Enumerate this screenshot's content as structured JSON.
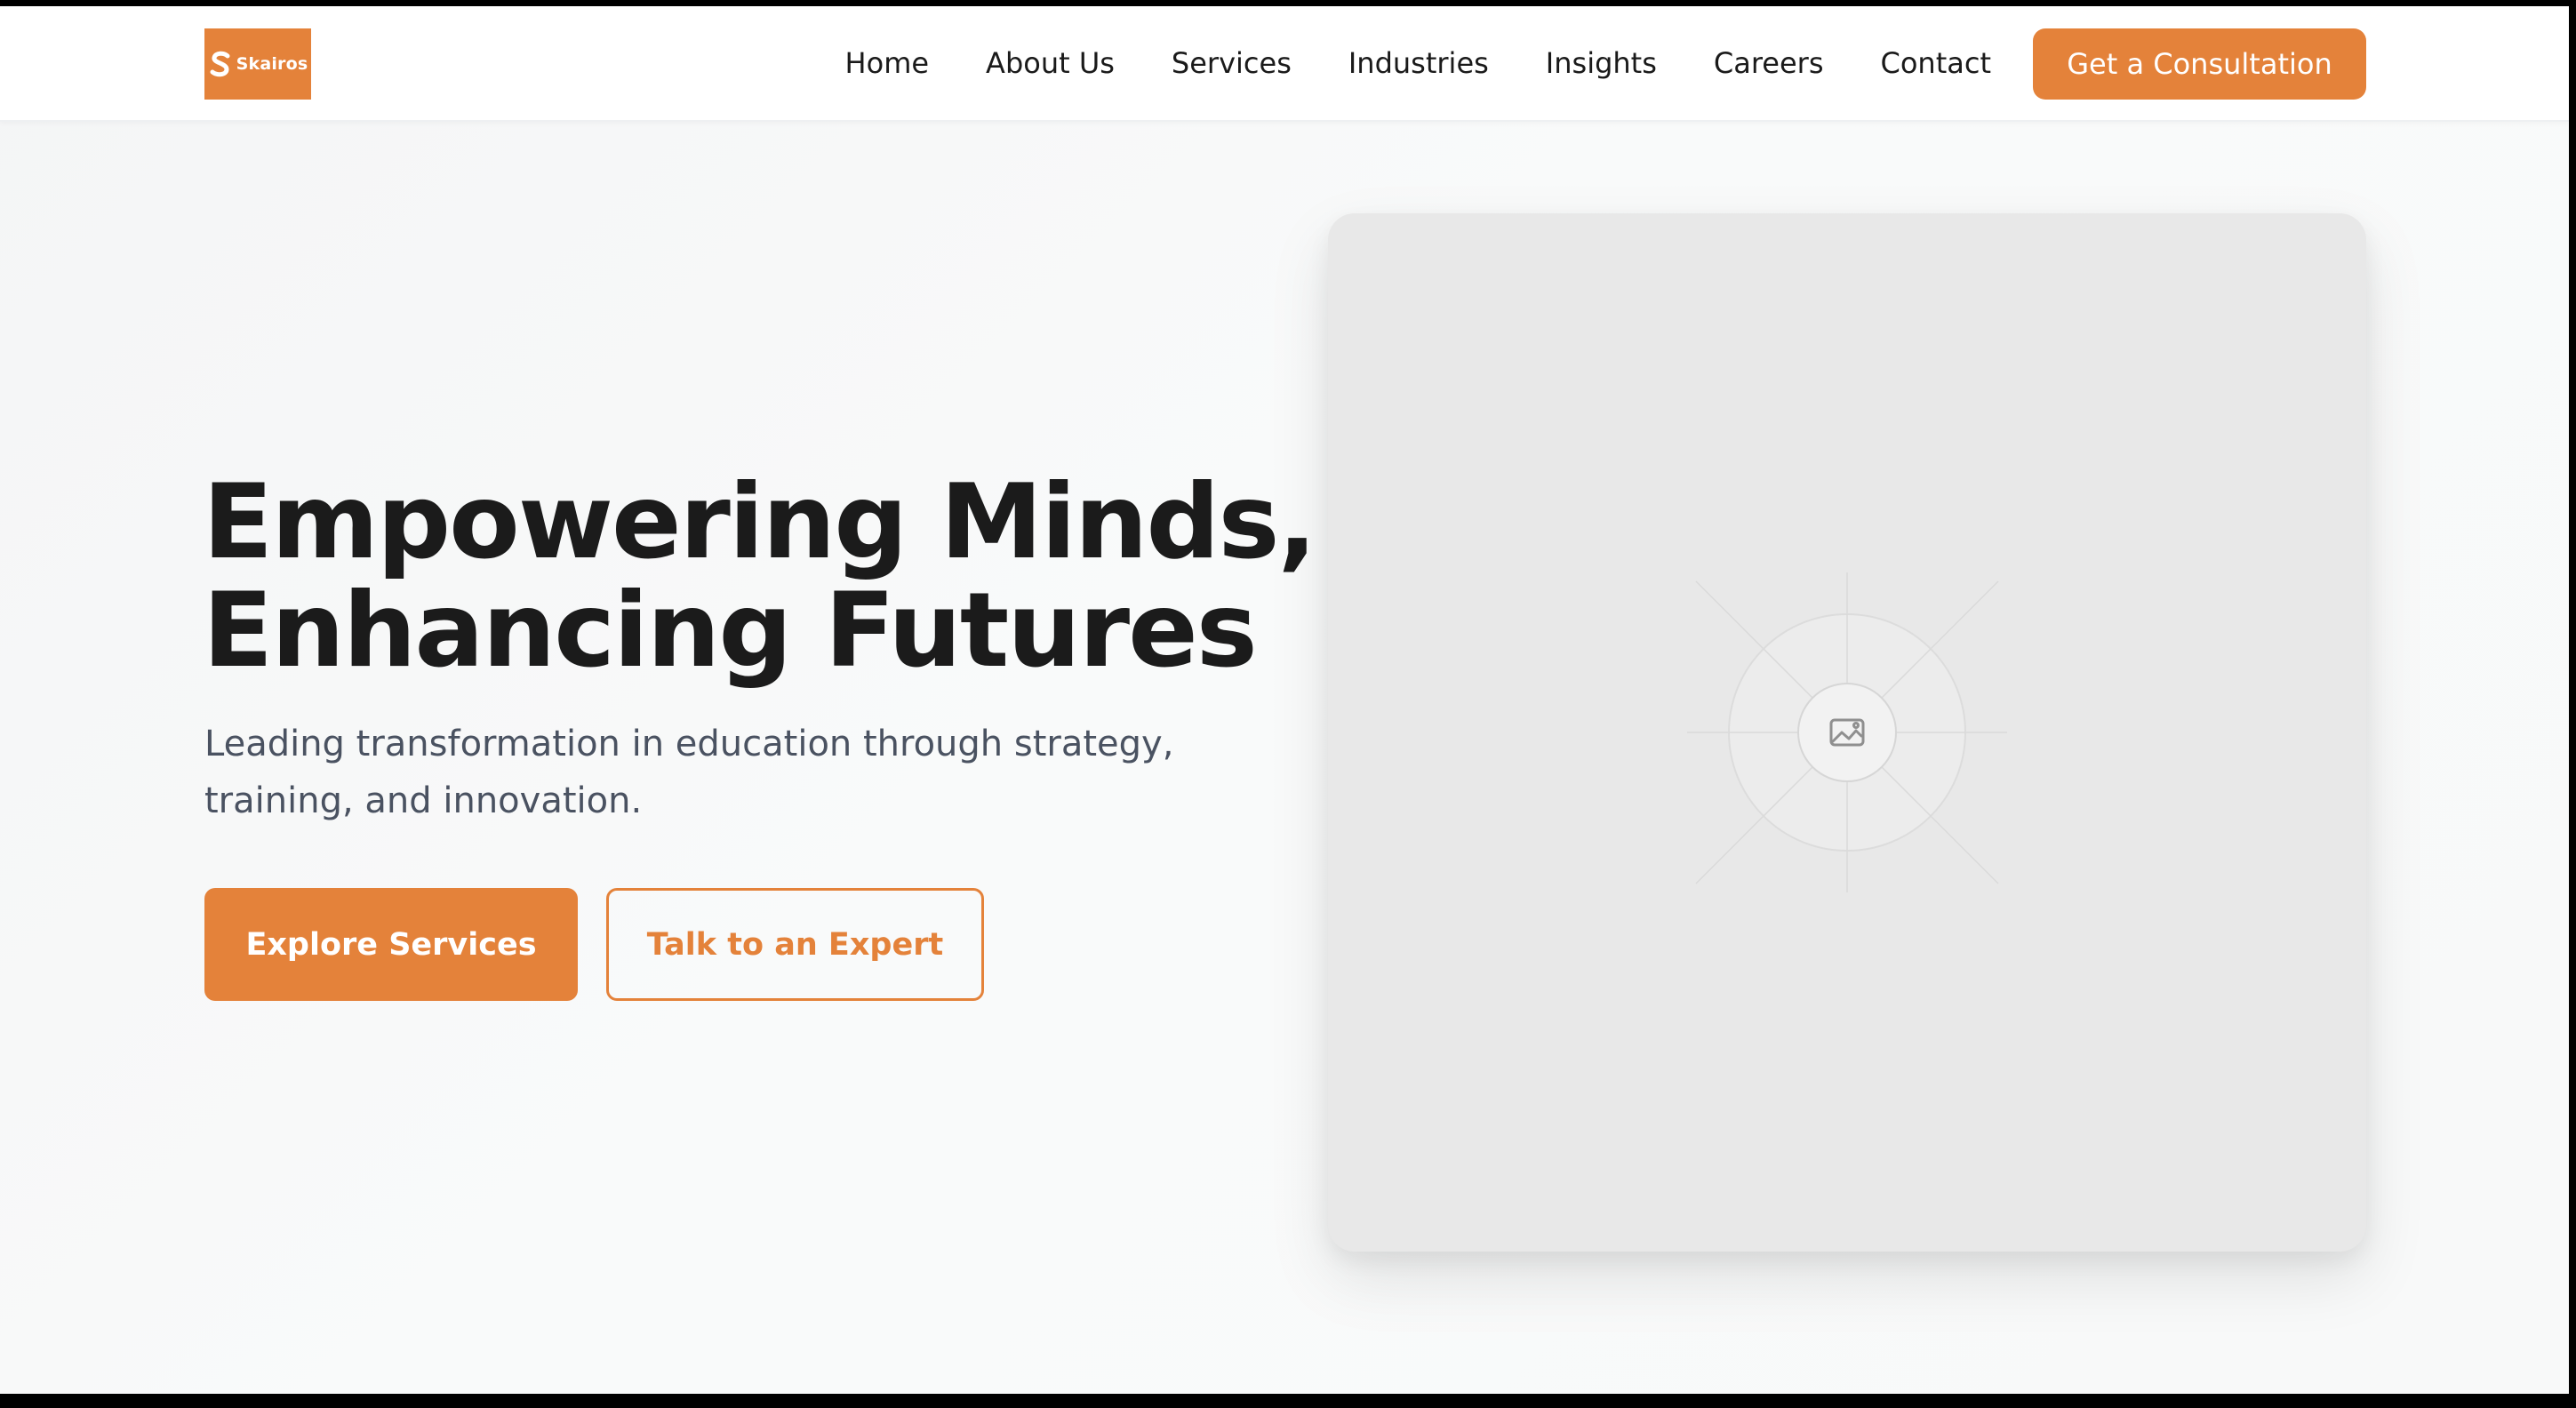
{
  "header": {
    "logo_text": "Skairos",
    "nav": [
      {
        "label": "Home"
      },
      {
        "label": "About Us"
      },
      {
        "label": "Services"
      },
      {
        "label": "Industries"
      },
      {
        "label": "Insights"
      },
      {
        "label": "Careers"
      },
      {
        "label": "Contact"
      }
    ],
    "cta_label": "Get a Consultation"
  },
  "hero": {
    "title_line1": "Empowering Minds,",
    "title_line2": "Enhancing Futures",
    "subtitle": "Leading transformation in education through strategy, training, and innovation.",
    "primary_button": "Explore Services",
    "secondary_button": "Talk to an Expert",
    "image_icon": "image-icon"
  },
  "colors": {
    "accent": "#e4823a",
    "heading": "#1b1b1b",
    "body_text": "#4a5261",
    "placeholder_bg": "#e8e8e8"
  }
}
